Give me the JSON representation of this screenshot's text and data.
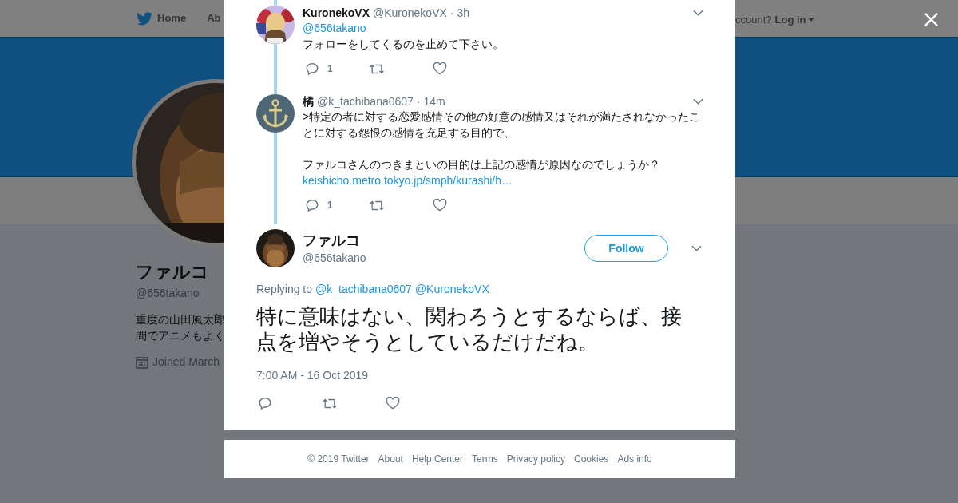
{
  "nav": {
    "items": [
      {
        "label": "Home"
      },
      {
        "label": "Ab"
      }
    ],
    "account_prompt": "ccount?",
    "login": "Log in"
  },
  "profile": {
    "name": "ファルコ",
    "handle": "@656takano",
    "bio_lines": [
      "重度の山田風太郎",
      "間でアニメもよく"
    ],
    "joined": "Joined March"
  },
  "thread": [
    {
      "name": "KuronekoVX",
      "handle": "@KuronekoVX",
      "separator": "·",
      "time": "3h",
      "mention": "@656takano",
      "paragraphs": [
        "フォローをしてくるのを止めて下さい。"
      ],
      "reply_count": "1",
      "kind": "picture"
    },
    {
      "name": "橘",
      "handle": "@k_tachibana0607",
      "separator": "·",
      "time": "14m",
      "paragraphs": [
        ">特定の者に対する恋愛感情その他の好意の感情又はそれが満たされなかったことに対する怨恨の感情を充足する目的で、",
        "ファルコさんのつきまといの目的は上記の感情が原因なのでしょうか？"
      ],
      "link": "keishicho.metro.tokyo.jp/smph/kurashi/h…",
      "reply_count": "1",
      "kind": "anchor"
    }
  ],
  "focused_tweet": {
    "name": "ファルコ",
    "handle": "@656takano",
    "follow_label": "Follow",
    "replying_label": "Replying to",
    "replying_to": [
      "@k_tachibana0607",
      "@KuronekoVX"
    ],
    "text": "特に意味はない、関わろうとするならば、接点を増やそうとしているだけだね。",
    "timestamp": "7:00 AM - 16 Oct 2019"
  },
  "footer": [
    "© 2019 Twitter",
    "About",
    "Help Center",
    "Terms",
    "Privacy policy",
    "Cookies",
    "Ads info"
  ]
}
